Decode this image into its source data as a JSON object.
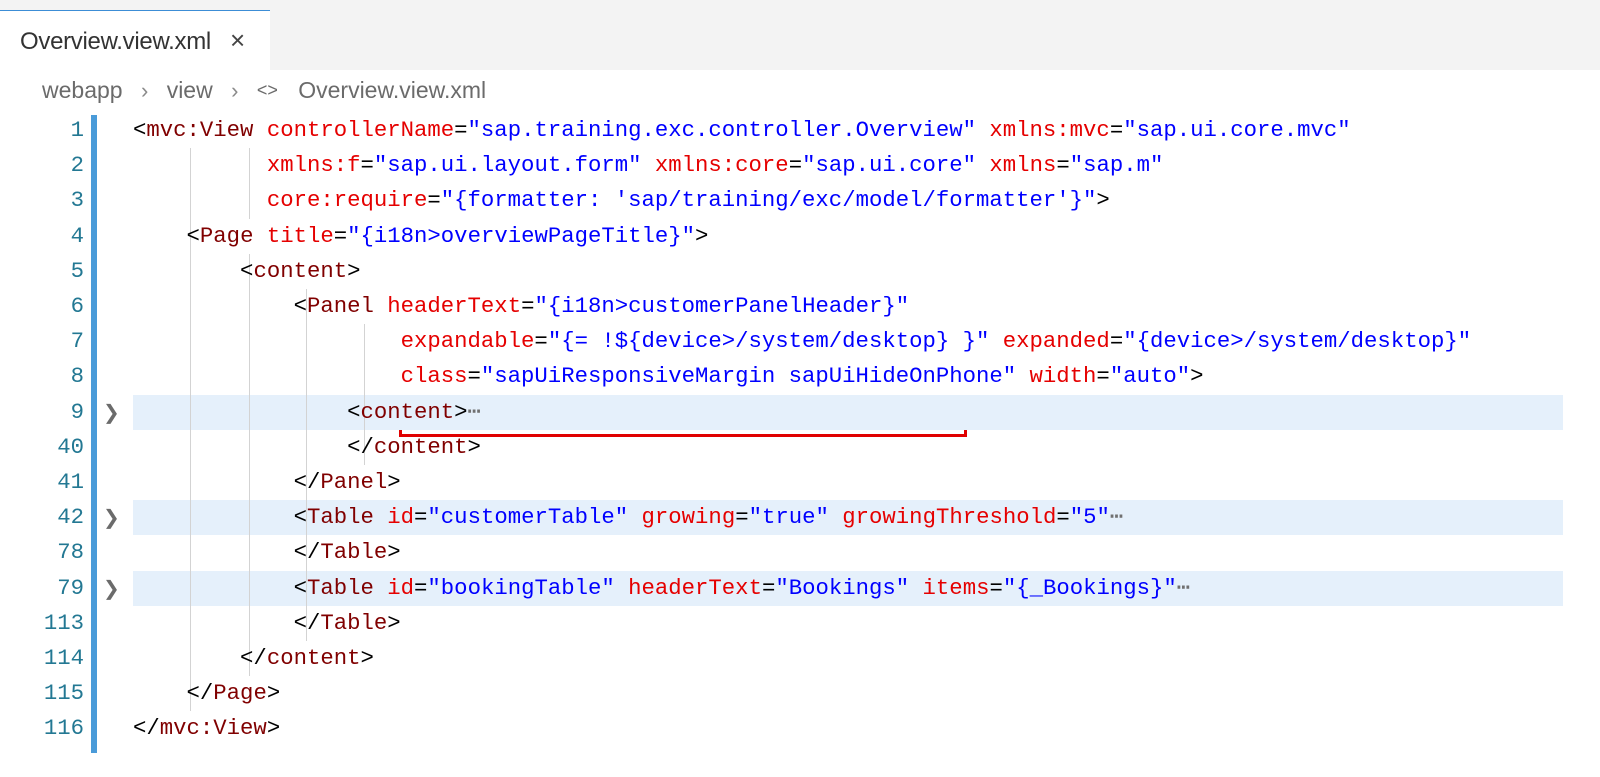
{
  "tab": {
    "title": "Overview.view.xml",
    "close_icon": "close-icon"
  },
  "breadcrumb": [
    "webapp",
    "view",
    "Overview.view.xml"
  ],
  "code_lines": [
    {
      "n": "1",
      "level": 0,
      "indent": "",
      "folded": false,
      "tokens": [
        {
          "c": "p",
          "t": "<"
        },
        {
          "c": "t",
          "t": "mvc:View"
        },
        {
          "c": "p",
          "t": " "
        },
        {
          "c": "a",
          "t": "controllerName"
        },
        {
          "c": "p",
          "t": "="
        },
        {
          "c": "v",
          "t": "\"sap.training.exc.controller.Overview\""
        },
        {
          "c": "p",
          "t": " "
        },
        {
          "c": "a",
          "t": "xmlns:mvc"
        },
        {
          "c": "p",
          "t": "="
        },
        {
          "c": "v",
          "t": "\"sap.ui.core.mvc\""
        }
      ]
    },
    {
      "n": "2",
      "level": 2,
      "indent": "          ",
      "folded": false,
      "tokens": [
        {
          "c": "a",
          "t": "xmlns:f"
        },
        {
          "c": "p",
          "t": "="
        },
        {
          "c": "v",
          "t": "\"sap.ui.layout.form\""
        },
        {
          "c": "p",
          "t": " "
        },
        {
          "c": "a",
          "t": "xmlns:core"
        },
        {
          "c": "p",
          "t": "="
        },
        {
          "c": "v",
          "t": "\"sap.ui.core\""
        },
        {
          "c": "p",
          "t": " "
        },
        {
          "c": "a",
          "t": "xmlns"
        },
        {
          "c": "p",
          "t": "="
        },
        {
          "c": "v",
          "t": "\"sap.m\""
        }
      ]
    },
    {
      "n": "3",
      "level": 2,
      "indent": "          ",
      "folded": false,
      "tokens": [
        {
          "c": "a",
          "t": "core:require"
        },
        {
          "c": "p",
          "t": "="
        },
        {
          "c": "v",
          "t": "\"{formatter: 'sap/training/exc/model/formatter'}\""
        },
        {
          "c": "p",
          "t": ">"
        }
      ]
    },
    {
      "n": "4",
      "level": 1,
      "indent": "    ",
      "folded": false,
      "tokens": [
        {
          "c": "p",
          "t": "<"
        },
        {
          "c": "t",
          "t": "Page"
        },
        {
          "c": "p",
          "t": " "
        },
        {
          "c": "a",
          "t": "title"
        },
        {
          "c": "p",
          "t": "="
        },
        {
          "c": "v",
          "t": "\"{i18n>overviewPageTitle}\""
        },
        {
          "c": "p",
          "t": ">"
        }
      ]
    },
    {
      "n": "5",
      "level": 2,
      "indent": "        ",
      "folded": false,
      "tokens": [
        {
          "c": "p",
          "t": "<"
        },
        {
          "c": "t",
          "t": "content"
        },
        {
          "c": "p",
          "t": ">"
        }
      ]
    },
    {
      "n": "6",
      "level": 3,
      "indent": "            ",
      "folded": false,
      "tokens": [
        {
          "c": "p",
          "t": "<"
        },
        {
          "c": "t",
          "t": "Panel"
        },
        {
          "c": "p",
          "t": " "
        },
        {
          "c": "a",
          "t": "headerText"
        },
        {
          "c": "p",
          "t": "="
        },
        {
          "c": "v",
          "t": "\"{i18n>customerPanelHeader}\""
        }
      ]
    },
    {
      "n": "7",
      "level": 5,
      "indent": "                    ",
      "folded": false,
      "tokens": [
        {
          "c": "a",
          "t": "expandable"
        },
        {
          "c": "p",
          "t": "="
        },
        {
          "c": "v",
          "t": "\"{= !${device>/system/desktop} }\""
        },
        {
          "c": "p",
          "t": " "
        },
        {
          "c": "a",
          "t": "expanded"
        },
        {
          "c": "p",
          "t": "="
        },
        {
          "c": "v",
          "t": "\"{device>/system/desktop}\""
        }
      ]
    },
    {
      "n": "8",
      "level": 5,
      "indent": "                    ",
      "folded": false,
      "tokens": [
        {
          "c": "a",
          "t": "class"
        },
        {
          "c": "p",
          "t": "="
        },
        {
          "c": "v",
          "t": "\"sapUiResponsiveMargin sapUiHideOnPhone\""
        },
        {
          "c": "p",
          "t": " "
        },
        {
          "c": "a",
          "t": "width"
        },
        {
          "c": "p",
          "t": "="
        },
        {
          "c": "v",
          "t": "\"auto\""
        },
        {
          "c": "p",
          "t": ">"
        }
      ]
    },
    {
      "n": "9",
      "level": 4,
      "indent": "                ",
      "folded": true,
      "tokens": [
        {
          "c": "p",
          "t": "<"
        },
        {
          "c": "t",
          "t": "content"
        },
        {
          "c": "p",
          "t": ">"
        },
        {
          "c": "e",
          "t": "⋯"
        }
      ]
    },
    {
      "n": "40",
      "level": 4,
      "indent": "                ",
      "folded": false,
      "tokens": [
        {
          "c": "p",
          "t": "</"
        },
        {
          "c": "t",
          "t": "content"
        },
        {
          "c": "p",
          "t": ">"
        }
      ]
    },
    {
      "n": "41",
      "level": 3,
      "indent": "            ",
      "folded": false,
      "tokens": [
        {
          "c": "p",
          "t": "</"
        },
        {
          "c": "t",
          "t": "Panel"
        },
        {
          "c": "p",
          "t": ">"
        }
      ]
    },
    {
      "n": "42",
      "level": 3,
      "indent": "            ",
      "folded": true,
      "tokens": [
        {
          "c": "p",
          "t": "<"
        },
        {
          "c": "t",
          "t": "Table"
        },
        {
          "c": "p",
          "t": " "
        },
        {
          "c": "a",
          "t": "id"
        },
        {
          "c": "p",
          "t": "="
        },
        {
          "c": "v",
          "t": "\"customerTable\""
        },
        {
          "c": "p",
          "t": " "
        },
        {
          "c": "a",
          "t": "growing"
        },
        {
          "c": "p",
          "t": "="
        },
        {
          "c": "v",
          "t": "\"true\""
        },
        {
          "c": "p",
          "t": " "
        },
        {
          "c": "a",
          "t": "growingThreshold"
        },
        {
          "c": "p",
          "t": "="
        },
        {
          "c": "v",
          "t": "\"5\""
        },
        {
          "c": "e",
          "t": "⋯"
        }
      ]
    },
    {
      "n": "78",
      "level": 3,
      "indent": "            ",
      "folded": false,
      "tokens": [
        {
          "c": "p",
          "t": "</"
        },
        {
          "c": "t",
          "t": "Table"
        },
        {
          "c": "p",
          "t": ">"
        }
      ]
    },
    {
      "n": "79",
      "level": 3,
      "indent": "            ",
      "folded": true,
      "tokens": [
        {
          "c": "p",
          "t": "<"
        },
        {
          "c": "t",
          "t": "Table"
        },
        {
          "c": "p",
          "t": " "
        },
        {
          "c": "a",
          "t": "id"
        },
        {
          "c": "p",
          "t": "="
        },
        {
          "c": "v",
          "t": "\"bookingTable\""
        },
        {
          "c": "p",
          "t": " "
        },
        {
          "c": "a",
          "t": "headerText"
        },
        {
          "c": "p",
          "t": "="
        },
        {
          "c": "v",
          "t": "\"Bookings\""
        },
        {
          "c": "p",
          "t": " "
        },
        {
          "c": "a",
          "t": "items"
        },
        {
          "c": "p",
          "t": "="
        },
        {
          "c": "v",
          "t": "\"{_Bookings}\""
        },
        {
          "c": "e",
          "t": "⋯"
        }
      ]
    },
    {
      "n": "113",
      "level": 3,
      "indent": "            ",
      "folded": false,
      "tokens": [
        {
          "c": "p",
          "t": "</"
        },
        {
          "c": "t",
          "t": "Table"
        },
        {
          "c": "p",
          "t": ">"
        }
      ]
    },
    {
      "n": "114",
      "level": 2,
      "indent": "        ",
      "folded": false,
      "tokens": [
        {
          "c": "p",
          "t": "</"
        },
        {
          "c": "t",
          "t": "content"
        },
        {
          "c": "p",
          "t": ">"
        }
      ]
    },
    {
      "n": "115",
      "level": 1,
      "indent": "    ",
      "folded": false,
      "tokens": [
        {
          "c": "p",
          "t": "</"
        },
        {
          "c": "t",
          "t": "Page"
        },
        {
          "c": "p",
          "t": ">"
        }
      ]
    },
    {
      "n": "116",
      "level": 0,
      "indent": "",
      "folded": false,
      "tokens": [
        {
          "c": "p",
          "t": "</"
        },
        {
          "c": "t",
          "t": "mvc:View"
        },
        {
          "c": "p",
          "t": ">"
        }
      ]
    }
  ],
  "colors": {
    "tag": "#800000",
    "attribute": "#e50000",
    "value": "#0000ff",
    "line_number": "#237893",
    "gutter_accent": "#4a9bd9",
    "folded_line_bg": "#e5f0fb",
    "highlight_box": "#e00000"
  }
}
